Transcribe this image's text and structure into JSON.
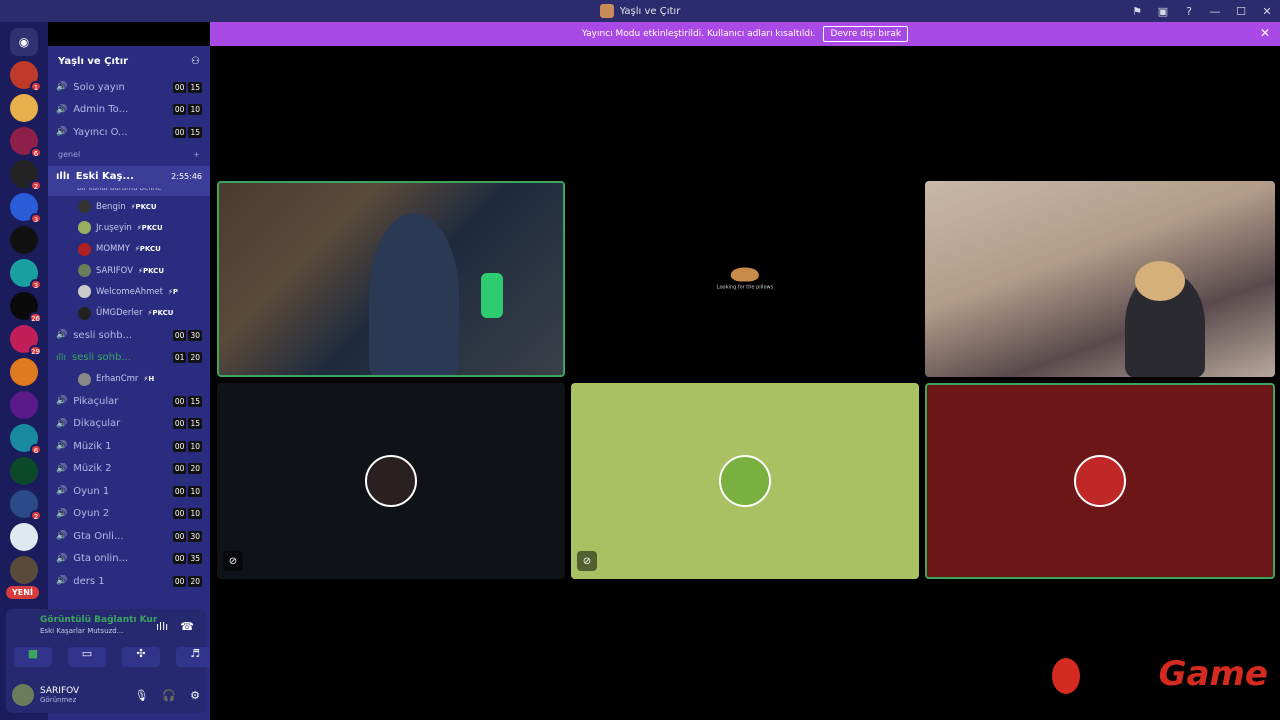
{
  "window": {
    "title": "Yaşlı ve Çıtır"
  },
  "banner": {
    "text": "Yayıncı Modu etkinleştirildi. Kullanıcı adları kısaltıldı.",
    "button": "Devre dışı bırak"
  },
  "guilds": [
    {
      "badge": "1",
      "color": "#c0392b"
    },
    {
      "badge": "",
      "color": "#e8b04a"
    },
    {
      "badge": "6",
      "color": "#8e1e4a"
    },
    {
      "badge": "2",
      "color": "#222222"
    },
    {
      "badge": "3",
      "color": "#2a5bd8"
    },
    {
      "badge": "",
      "color": "#111111"
    },
    {
      "badge": "3",
      "color": "#1aa0a0"
    },
    {
      "badge": "26",
      "color": "#0a0a0a"
    },
    {
      "badge": "29",
      "color": "#c01f5a"
    },
    {
      "badge": "",
      "color": "#e07a20"
    },
    {
      "badge": "",
      "color": "#5a1a8a"
    },
    {
      "badge": "6",
      "color": "#1a8aa0"
    },
    {
      "badge": "",
      "color": "#0a4a2a"
    },
    {
      "badge": "2",
      "color": "#2a4a8a"
    },
    {
      "badge": "",
      "color": "#e0e8f0"
    },
    {
      "badge": "",
      "color": "#5a4a3a"
    }
  ],
  "new_badge": "YENİ",
  "server": {
    "name": "Yaşlı ve Çıtır"
  },
  "channels_top": [
    {
      "name": "Solo yayın",
      "a": "00",
      "b": "15"
    },
    {
      "name": "Admin To...",
      "a": "00",
      "b": "10"
    },
    {
      "name": "Yayıncı Ö...",
      "a": "00",
      "b": "15"
    }
  ],
  "category": "genel",
  "active_channel": {
    "name": "Eski Kaş...",
    "time": "2:55:46",
    "status": "Bir kanal durumu belirle"
  },
  "members": [
    {
      "name": "Bengin",
      "tag": "⚡PKCU",
      "color": "#333"
    },
    {
      "name": "Jr.uşeyin",
      "tag": "⚡PKCU",
      "color": "#9ab060"
    },
    {
      "name": "MOMMY",
      "tag": "⚡PKCU",
      "color": "#b02020"
    },
    {
      "name": "SARIFOV",
      "tag": "⚡PKCU",
      "color": "#6b7c5a"
    },
    {
      "name": "WelcomeAhmet",
      "tag": "⚡P",
      "color": "#ccc"
    },
    {
      "name": "ÜMGDerler",
      "tag": "⚡PKCU",
      "color": "#222"
    }
  ],
  "channels_mid": [
    {
      "name": "sesli sohb...",
      "a": "00",
      "b": "30",
      "hl": false
    },
    {
      "name": "sesli sohb...",
      "a": "01",
      "b": "20",
      "hl": true
    }
  ],
  "member2": {
    "name": "ErhanCmr",
    "tag": "⚡H"
  },
  "channels_bottom": [
    {
      "name": "Pikaçular",
      "a": "00",
      "b": "15"
    },
    {
      "name": "Dikaçular",
      "a": "00",
      "b": "15"
    },
    {
      "name": "Müzik 1",
      "a": "00",
      "b": "10"
    },
    {
      "name": "Müzik 2",
      "a": "00",
      "b": "20"
    },
    {
      "name": "Oyun 1",
      "a": "00",
      "b": "10"
    },
    {
      "name": "Oyun 2",
      "a": "00",
      "b": "10"
    },
    {
      "name": "Gta Onli...",
      "a": "00",
      "b": "30"
    },
    {
      "name": "Gta onlin...",
      "a": "00",
      "b": "35"
    },
    {
      "name": "ders 1",
      "a": "00",
      "b": "20"
    }
  ],
  "voice": {
    "status": "Görüntülü Bağlantı Kur",
    "sub": "Eski Kaşarlar Mutsuzd..."
  },
  "user": {
    "name": "SARIFOV",
    "status": "Görünmez"
  },
  "tile_loading": "Looking for the pillows",
  "watermark": "Game",
  "colors": {
    "speaking": "#3ba55d",
    "banner": "#a94ae6",
    "sidebar": "#2a2c80"
  }
}
